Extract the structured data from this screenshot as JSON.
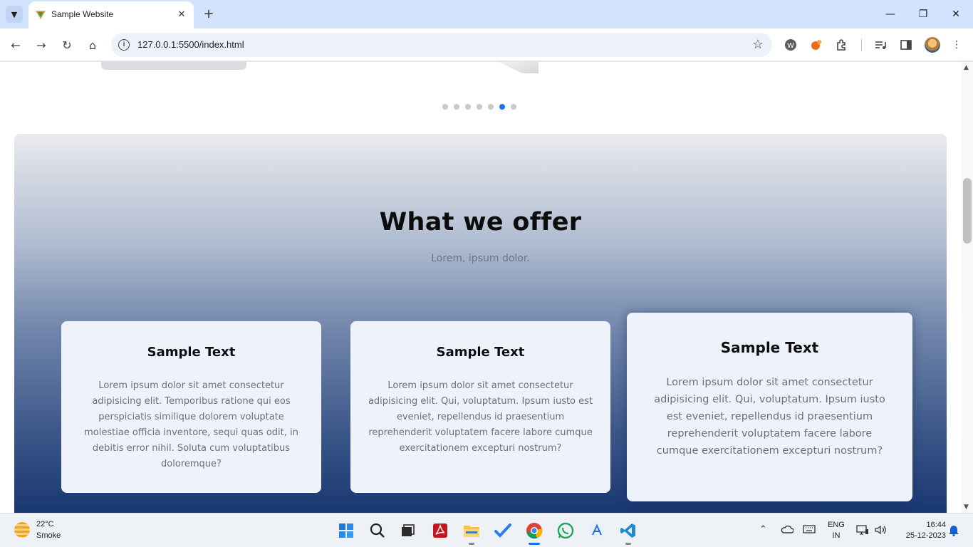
{
  "browser": {
    "tab_title": "Sample Website",
    "url": "127.0.0.1:5500/index.html"
  },
  "page": {
    "carousel": {
      "total_dots": 7,
      "active_dot": 6
    },
    "section": {
      "title": "What we offer",
      "subtitle": "Lorem, ipsum dolor.",
      "cards": [
        {
          "title": "Sample Text",
          "body": "Lorem ipsum dolor sit amet consectetur adipisicing elit. Temporibus ratione qui eos perspiciatis similique dolorem voluptate molestiae officia inventore, sequi quas odit, in debitis error nihil. Soluta cum voluptatibus doloremque?"
        },
        {
          "title": "Sample Text",
          "body": "Lorem ipsum dolor sit amet consectetur adipisicing elit. Qui, voluptatum. Ipsum iusto est eveniet, repellendus id praesentium reprehenderit voluptatem facere labore cumque exercitationem excepturi nostrum?"
        },
        {
          "title": "Sample Text",
          "body": "Lorem ipsum dolor sit amet consectetur adipisicing elit. Qui, voluptatum. Ipsum iusto est eveniet, repellendus id praesentium reprehenderit voluptatem facere labore cumque exercitationem excepturi nostrum?"
        }
      ]
    }
  },
  "taskbar": {
    "weather": {
      "temp": "22°C",
      "desc": "Smoke"
    },
    "lang": {
      "line1": "ENG",
      "line2": "IN"
    },
    "clock": {
      "time": "16:44",
      "date": "25-12-2023"
    }
  },
  "colors": {
    "accent": "#1a73e8",
    "card_bg": "#eef3fb",
    "gradient_top": "#e9eaee",
    "gradient_bottom": "#10306a"
  }
}
